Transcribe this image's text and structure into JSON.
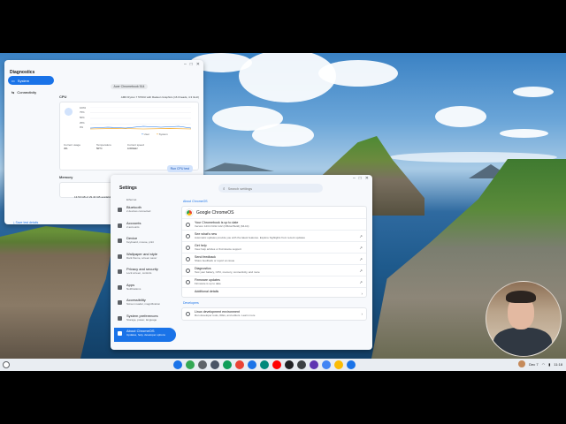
{
  "diagnostics": {
    "title": "Diagnostics",
    "nav": [
      {
        "label": "System",
        "icon": "laptop-icon"
      },
      {
        "label": "Connectivity",
        "icon": "connectivity-icon"
      }
    ],
    "system_pill": "Acer Chromebook 514",
    "cpu": {
      "heading": "CPU",
      "model": "AMD Ryzen 7 5700U with Radeon Graphics (16 threads, 4.3 GHz)",
      "y_ticks": [
        "100%",
        "75%",
        "50%",
        "25%",
        "0%"
      ],
      "legend_user": "User",
      "legend_system": "System",
      "current_usage_label": "Current usage",
      "current_usage_value": "4%",
      "temperature_label": "Temperature",
      "temperature_value": "50°C",
      "speed_label": "Current speed",
      "speed_value": "4.00GHz",
      "run_button": "Run CPU test"
    },
    "memory": {
      "heading": "Memory",
      "value": "13.50 GB of 29.40 GB available"
    },
    "save_button": "Save test details"
  },
  "settings": {
    "title": "Settings",
    "search_placeholder": "Search settings",
    "nav": [
      {
        "title": "Bluetooth",
        "sub": "2 devices connected"
      },
      {
        "title": "Accounts",
        "sub": "2 accounts"
      },
      {
        "title": "Device",
        "sub": "Keyboard, mouse, print"
      },
      {
        "title": "Wallpaper and style",
        "sub": "Dark theme, screen saver"
      },
      {
        "title": "Privacy and security",
        "sub": "Lock screen, controls"
      },
      {
        "title": "Apps",
        "sub": "Notifications"
      },
      {
        "title": "Accessibility",
        "sub": "Screen reader, magnification"
      },
      {
        "title": "System preferences",
        "sub": "Storage, power, language"
      },
      {
        "title": "About ChromeOS",
        "sub": "Updates, help, developer options"
      }
    ],
    "nav_partial": "Ethernet",
    "about_label": "About ChromeOS",
    "product_name": "Google ChromeOS",
    "rows": [
      {
        "title": "Your Chromebook is up to date",
        "sub": "Version 123.0.6312.122 (Official Build) (64-bit)",
        "ext": false
      },
      {
        "title": "See what's new",
        "sub": "Automatic updates provide you with the latest features. Explore highlights from recent updates",
        "ext": true
      },
      {
        "title": "Get help",
        "sub": "View help articles or find device support",
        "ext": true
      },
      {
        "title": "Send feedback",
        "sub": "Share feedback or report an issue",
        "ext": true
      },
      {
        "title": "Diagnostics",
        "sub": "Test your battery, CPU, memory, connectivity, and more",
        "ext": true
      },
      {
        "title": "Firmware updates",
        "sub": "Firmware is up to date",
        "ext": true
      },
      {
        "title": "Additional details",
        "sub": "",
        "ext": false
      }
    ],
    "developers_label": "Developers",
    "linux": {
      "title": "Linux development environment",
      "sub": "Run developer tools, IDEs, and editors. Learn more"
    }
  },
  "taskbar": {
    "apps": [
      {
        "name": "files-app-icon",
        "color": "#1a73e8"
      },
      {
        "name": "chrome-app-icon",
        "color": "#34a853"
      },
      {
        "name": "camera-app-icon",
        "color": "#5f6368"
      },
      {
        "name": "settings-app-icon",
        "color": "#4a5566"
      },
      {
        "name": "play-store-app-icon",
        "color": "#0f9d58"
      },
      {
        "name": "gmail-app-icon",
        "color": "#ea4335"
      },
      {
        "name": "docs-app-icon",
        "color": "#1a73e8"
      },
      {
        "name": "meet-app-icon",
        "color": "#00897b"
      },
      {
        "name": "youtube-app-icon",
        "color": "#ff0000"
      },
      {
        "name": "terminal-app-icon",
        "color": "#202124"
      },
      {
        "name": "diagnostics-app-icon",
        "color": "#3c4043"
      },
      {
        "name": "screen-capture-app-icon",
        "color": "#5e35b1"
      },
      {
        "name": "calculator-app-icon",
        "color": "#4285f4"
      },
      {
        "name": "photos-app-icon",
        "color": "#fbbc04"
      },
      {
        "name": "help-app-icon",
        "color": "#1a73e8"
      }
    ],
    "date": "Dec 7",
    "time": "11:18"
  }
}
